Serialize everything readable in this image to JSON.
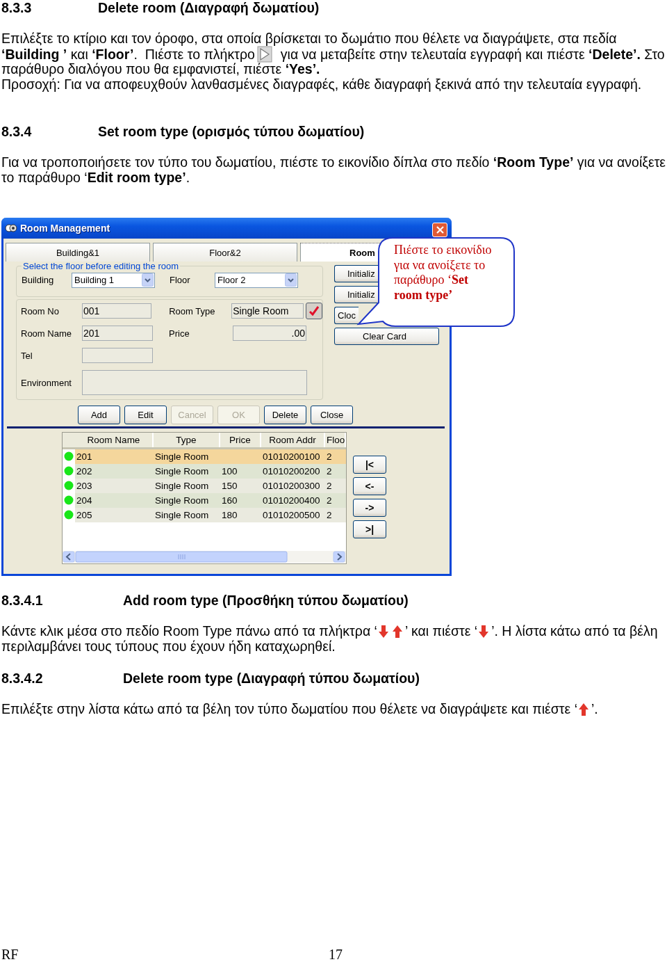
{
  "document": [
    {
      "kind": "heading",
      "number": "8.3.3",
      "title": "Delete room (Διαγραφή δωματίου)"
    },
    {
      "kind": "paragraph",
      "lines": [
        [
          {
            "kind": "text",
            "text": "Επιλέξτε το κτίριο και τον όροφο, στα οποία βρίσκεται το δωμάτιο που θέλετε να διαγράψετε, στα πεδία"
          }
        ],
        [
          {
            "kind": "text",
            "text": "**‘Building ’** και **‘Floor’**.  Πιέστε το πλήκτρο"
          },
          {
            "kind": "play"
          },
          {
            "kind": "text",
            "text": "για να μεταβείτε στην τελευταία εγγραφή και πιέστε **‘Delete’.** Στο"
          }
        ],
        [
          {
            "kind": "text",
            "text": "παράθυρο διαλόγου που θα εμφανιστεί, πιέστε **‘Yes’.**"
          }
        ]
      ]
    },
    {
      "kind": "note",
      "lines": [
        [
          {
            "kind": "text",
            "text": "Προσοχή: Για να αποφευχθούν λανθασμένες διαγραφές, κάθε διαγραφή ξεκινά από την τελευταία εγγραφή."
          }
        ]
      ]
    },
    {
      "kind": "heading",
      "number": "8.3.4",
      "title": "Set room type (ορισμός τύπου δωματίου)"
    },
    {
      "kind": "paragraph",
      "lines": [
        [
          {
            "kind": "text",
            "text": "Για να τροποποιήσετε τον τύπο του δωματίου, πιέστε το εικονίδιο δίπλα στο πεδίο **‘Room Type’** για να ανοίξετε"
          }
        ],
        [
          {
            "kind": "text",
            "text": "το παράθυρο ‘**Edit room type’**."
          }
        ]
      ]
    },
    {
      "kind": "screenshot",
      "window": {
        "title": "Room Management",
        "tabs": [
          {
            "label": "Building&1",
            "selected": false
          },
          {
            "label": "Floor&2",
            "selected": false
          },
          {
            "label": "Room",
            "selected": true
          }
        ],
        "filter": {
          "legend": "Select the floor before editing the room",
          "building_label": "Building",
          "building": "Building 1",
          "floor_label": "Floor",
          "floor": "Floor 2"
        },
        "fields": {
          "room_no_label": "Room No",
          "room_no": "001",
          "room_type_label": "Room Type",
          "room_type": "Single Room",
          "room_name_label": "Room Name",
          "room_name": "201",
          "price_label": "Price",
          "price": ".00",
          "tel_label": "Tel",
          "environment_label": "Environment"
        },
        "side_buttons": [
          "Initializ",
          "Initializ",
          "Cloc",
          "Clear Card"
        ],
        "buttons": [
          {
            "label": "Add",
            "disabled": false
          },
          {
            "label": "Edit",
            "disabled": false
          },
          {
            "label": "Cancel",
            "disabled": true
          },
          {
            "label": "OK",
            "disabled": true
          },
          {
            "label": "Delete",
            "disabled": false
          },
          {
            "label": "Close",
            "disabled": false
          }
        ],
        "grid": {
          "columns": [
            "Room Name",
            "Type",
            "Price",
            "Room Addr",
            "Floo"
          ],
          "rows": [
            {
              "room_name": "201",
              "type": "Single Room",
              "room_addr": "01010200100",
              "floor": "2",
              "selected": true
            },
            {
              "room_name": "202",
              "type": "Single Room",
              "price": "100",
              "room_addr": "01010200200",
              "floor": "2",
              "selected": false
            },
            {
              "room_name": "203",
              "type": "Single Room",
              "price": "150",
              "room_addr": "01010200300",
              "floor": "2",
              "selected": false
            },
            {
              "room_name": "204",
              "type": "Single Room",
              "price": "160",
              "room_addr": "01010200400",
              "floor": "2",
              "selected": false
            },
            {
              "room_name": "205",
              "type": "Single Room",
              "price": "180",
              "room_addr": "01010200500",
              "floor": "2",
              "selected": false
            }
          ]
        },
        "nav_buttons": [
          "|<",
          "<-",
          "->",
          ">|"
        ],
        "callout": "Πιέστε το εικονίδιο για να ανοίξετε το παράθυρο ‘**Set room type’**"
      }
    },
    {
      "kind": "subheading",
      "number": "8.3.4.1",
      "title": "Add room type (Προσθήκη τύπου δωματίου)"
    },
    {
      "kind": "paragraph",
      "lines": [
        [
          {
            "kind": "text",
            "text": "Κάντε κλικ μέσα στο πεδίο Room Type πάνω από τα πλήκτρα ‘"
          },
          {
            "kind": "down"
          },
          {
            "kind": "up"
          },
          {
            "kind": "text",
            "text": "’ και πιέστε ‘"
          },
          {
            "kind": "down"
          },
          {
            "kind": "text",
            "text": "’. Η λίστα κάτω από τα βέλη"
          }
        ],
        [
          {
            "kind": "text",
            "text": "περιλαμβάνει τους τύπους που έχουν ήδη καταχωρηθεί."
          }
        ]
      ]
    },
    {
      "kind": "subheading",
      "number": "8.3.4.2",
      "title": "Delete room type (Διαγραφή τύπου δωματίου)"
    },
    {
      "kind": "paragraph",
      "lines": [
        [
          {
            "kind": "text",
            "text": "Επιλέξτε στην λίστα κάτω από τα βέλη τον τύπο δωματίου που θέλετε να διαγράψετε και πιέστε ‘"
          },
          {
            "kind": "up"
          },
          {
            "kind": "text",
            "text": "’."
          }
        ]
      ]
    }
  ],
  "footer": {
    "left": "RF",
    "page": "17"
  }
}
